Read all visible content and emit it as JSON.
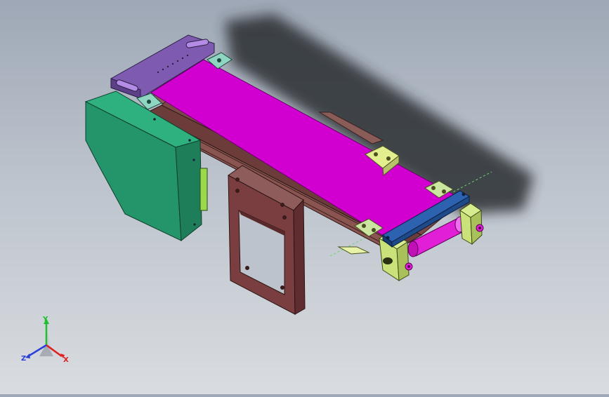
{
  "viewport": {
    "background_top": "#9ea8b6",
    "background_bottom": "#d9dce0"
  },
  "model": {
    "belt_color": "#d100d1",
    "motor_cover_color": "#2a9a6e",
    "top_plate_color": "#7e5bb0",
    "mount_bracket_color": "#7a3e40",
    "end_bracket_color": "#c9e37a",
    "end_bar_color": "#1e4a8a",
    "roller_color": "#e11fd6",
    "frame_color": "#7e4e4c"
  },
  "triad": {
    "x_label": "X",
    "y_label": "Y",
    "z_label": "Z",
    "x_color": "#e01e1e",
    "y_color": "#1fbf2f",
    "z_color": "#2a3fd8"
  }
}
